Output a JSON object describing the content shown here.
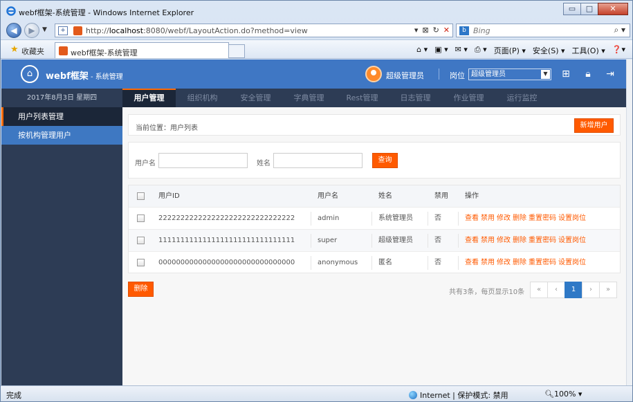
{
  "browser": {
    "window_title": "webf框架-系统管理 - Windows Internet Explorer",
    "url_prefix": "http://",
    "url_host": "localhost",
    "url_rest": ":8080/webf/LayoutAction.do?method=view",
    "search_placeholder": "Bing",
    "favorites_label": "收藏夹",
    "tab_title": "webf框架-系统管理",
    "commands": [
      "页面(P) ▾",
      "安全(S) ▾",
      "工具(O) ▾"
    ],
    "status_done": "完成",
    "status_zone": "Internet | 保护模式: 禁用",
    "status_zoom": "100%"
  },
  "app": {
    "name": "webf框架",
    "subtitle": " - 系统管理",
    "user_name": "超级管理员",
    "post_label": "岗位",
    "post_value": "超级管理员",
    "date": "2017年8月3日 星期四"
  },
  "nav": {
    "tabs": [
      "用户管理",
      "组织机构",
      "安全管理",
      "字典管理",
      "Rest管理",
      "日志管理",
      "作业管理",
      "运行监控"
    ]
  },
  "sidebar": {
    "items": [
      "用户列表管理",
      "按机构管理用户"
    ]
  },
  "main": {
    "breadcrumb": "当前位置：用户列表",
    "add_button": "新增用户",
    "search": {
      "username_label": "用户名",
      "realname_label": "姓名",
      "query_button": "查询"
    },
    "table": {
      "headers": [
        "用户ID",
        "用户名",
        "姓名",
        "禁用",
        "操作"
      ],
      "rows": [
        [
          "2222222222222222222222222222222",
          "admin",
          "系统管理员",
          "否"
        ],
        [
          "1111111111111111111111111111111",
          "super",
          "超级管理员",
          "否"
        ],
        [
          "0000000000000000000000000000000",
          "anonymous",
          "匿名",
          "否"
        ]
      ],
      "actions": [
        "查看",
        "禁用",
        "修改",
        "删除",
        "重置密码",
        "设置岗位"
      ]
    },
    "delete_button": "删除",
    "page_info": "共有3条，每页显示10条",
    "pager": [
      "«",
      "‹",
      "1",
      "›",
      "»"
    ]
  },
  "colors": {
    "header_blue": "#3f77c4",
    "nav_dark": "#2d3c55",
    "accent_orange": "#ff5a00",
    "pager_active": "#2f79c6"
  }
}
